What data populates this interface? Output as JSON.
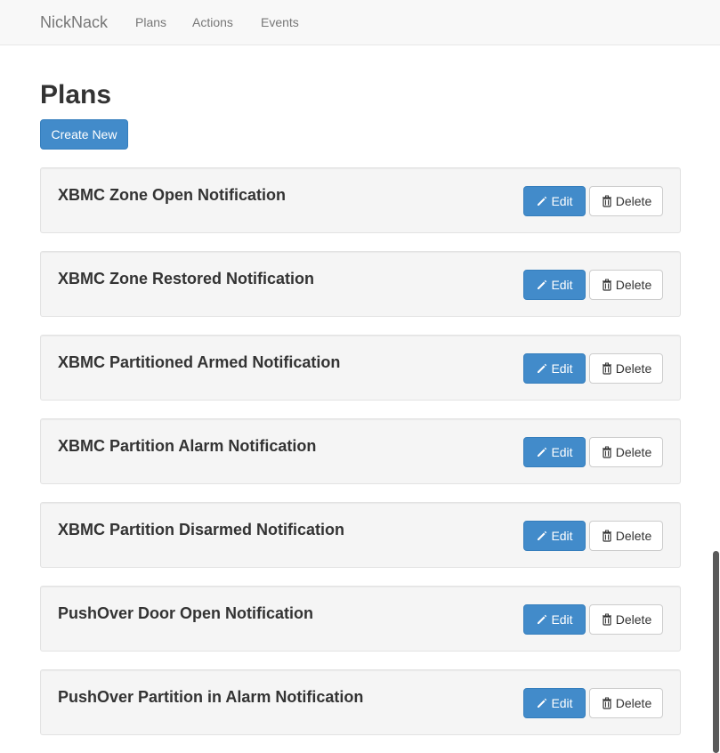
{
  "navbar": {
    "brand": "NickNack",
    "links": [
      {
        "label": "Plans"
      },
      {
        "label": "Actions"
      },
      {
        "label": "Events"
      }
    ]
  },
  "page": {
    "title": "Plans",
    "create_label": "Create New"
  },
  "plans": [
    {
      "name": "XBMC Zone Open Notification"
    },
    {
      "name": "XBMC Zone Restored Notification"
    },
    {
      "name": "XBMC Partitioned Armed Notification"
    },
    {
      "name": "XBMC Partition Alarm Notification"
    },
    {
      "name": "XBMC Partition Disarmed Notification"
    },
    {
      "name": "PushOver Door Open Notification"
    },
    {
      "name": "PushOver Partition in Alarm Notification"
    }
  ],
  "actions": {
    "edit_label": "Edit",
    "delete_label": "Delete",
    "edit_icon": "pencil-icon",
    "delete_icon": "trash-icon"
  },
  "colors": {
    "primary": "#428bca",
    "panel_bg": "#f5f5f5",
    "navbar_bg": "#f8f8f8"
  }
}
